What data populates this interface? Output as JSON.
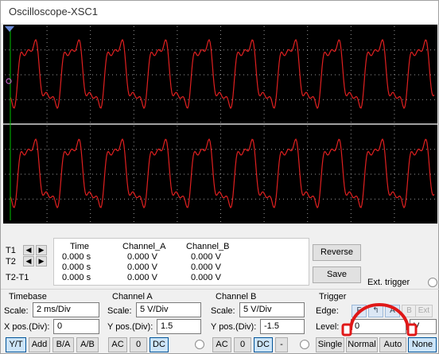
{
  "window": {
    "title": "Oscilloscope-XSC1"
  },
  "readout": {
    "row_labels": [
      "T1",
      "T2",
      "T2-T1"
    ],
    "headers": [
      "Time",
      "Channel_A",
      "Channel_B"
    ],
    "rows": [
      [
        "0.000 s",
        "0.000 V",
        "0.000 V"
      ],
      [
        "0.000 s",
        "0.000 V",
        "0.000 V"
      ],
      [
        "0.000 s",
        "0.000 V",
        "0.000 V"
      ]
    ]
  },
  "actions": {
    "reverse": "Reverse",
    "save": "Save",
    "ext_trigger": "Ext. trigger"
  },
  "timebase": {
    "title": "Timebase",
    "scale_label": "Scale:",
    "scale_value": "2 ms/Div",
    "xpos_label": "X pos.(Div):",
    "xpos_value": "0",
    "modes": [
      "Y/T",
      "Add",
      "B/A",
      "A/B"
    ]
  },
  "channel_a": {
    "title": "Channel A",
    "scale_label": "Scale:",
    "scale_value": "5  V/Div",
    "ypos_label": "Y pos.(Div):",
    "ypos_value": "1.5",
    "coupling": [
      "AC",
      "0",
      "DC"
    ]
  },
  "channel_b": {
    "title": "Channel B",
    "scale_label": "Scale:",
    "scale_value": "5  V/Div",
    "ypos_label": "Y pos.(Div):",
    "ypos_value": "-1.5",
    "coupling": [
      "AC",
      "0",
      "DC",
      "-"
    ]
  },
  "trigger": {
    "title": "Trigger",
    "edge_label": "Edge:",
    "edge_buttons": [
      "F",
      "↰",
      "A",
      "B",
      "Ext"
    ],
    "level_label": "Level:",
    "level_value": "0",
    "level_unit": "V",
    "modes": [
      "Single",
      "Normal",
      "Auto",
      "None"
    ]
  },
  "colors": {
    "trace": "#e02020",
    "screen": "#000000",
    "grid": "#ffffff",
    "cursor": "#00c000"
  }
}
